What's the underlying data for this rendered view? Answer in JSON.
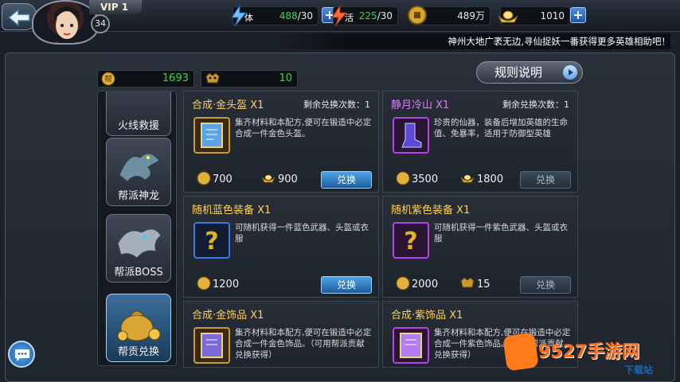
{
  "header": {
    "vip": "VIP 1",
    "level": "34",
    "stamina": {
      "label": "体",
      "value": "488",
      "max": "/30"
    },
    "vitality": {
      "label": "活",
      "value": "225",
      "max": "/30"
    },
    "coins": "489万",
    "ingots": "1010",
    "plus": "+",
    "marquee": "神州大地广袤无边,寻仙捉妖一番获得更多英雄相助吧！"
  },
  "counters": {
    "contribution": "1693",
    "boss_token": "10"
  },
  "rules_button": "规则说明",
  "sidebar": [
    {
      "label": "火线救援",
      "icon": "fire-rescue-icon"
    },
    {
      "label": "帮派神龙",
      "icon": "dragon-icon"
    },
    {
      "label": "帮派BOSS",
      "icon": "boss-icon"
    },
    {
      "label": "帮贡兑换",
      "icon": "money-bag-icon",
      "active": true
    }
  ],
  "items": [
    {
      "title": "合成·金头盔 X1",
      "remain": "剩余兑换次数：1",
      "desc": "集齐材料和本配方,便可在锻造中必定合成一件金色头盔。",
      "price1": "700",
      "price2": "900",
      "button": "兑换",
      "enabled": true
    },
    {
      "title": "静月冷山 X1",
      "remain": "剩余兑换次数：1",
      "desc": "珍贵的仙器，装备后增加英雄的生命值、免暴率，适用于防御型英雄",
      "price1": "3500",
      "price2": "1800",
      "button": "兑换",
      "enabled": false
    },
    {
      "title": "随机蓝色装备 X1",
      "desc": "可随机获得一件蓝色武器、头盔或衣服",
      "price1": "1200",
      "button": "兑换",
      "enabled": true
    },
    {
      "title": "随机紫色装备 X1",
      "desc": "可随机获得一件紫色武器、头盔或衣服",
      "price1": "2000",
      "price2": "15",
      "button": "兑换",
      "enabled": false
    },
    {
      "title": "合成·金饰品 X1",
      "desc": "集齐材料和本配方,便可在锻造中必定合成一件金色饰品。（可用帮派贡献兑换获得）"
    },
    {
      "title": "合成·紫饰品 X1",
      "desc": "集齐材料和本配方,便可在锻造中必定合成一件紫色饰品。（可用帮派贡献兑换获得）"
    }
  ],
  "watermark": {
    "main": "9527手游网",
    "sub": "下载站"
  },
  "colors": {
    "accent": "#3fd24a",
    "gold_title": "#ffd15a",
    "purple_title": "#e37bff",
    "button_blue": "#2f7ec2"
  }
}
